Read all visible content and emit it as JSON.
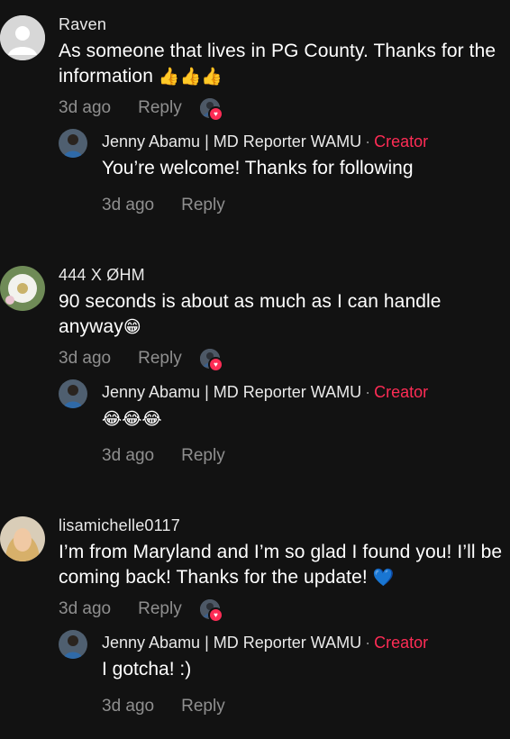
{
  "comments": [
    {
      "username": "Raven",
      "text": "As someone that lives in PG County. Thanks for the information",
      "emoji": "👍👍👍",
      "time": "3d ago",
      "reply_label": "Reply",
      "reply": {
        "author": "Jenny Abamu | MD Reporter WAMU",
        "separator": "·",
        "badge": "Creator",
        "text": "You’re welcome! Thanks for following",
        "emoji": "",
        "time": "3d ago",
        "reply_label": "Reply"
      }
    },
    {
      "username": "444 X ØHM",
      "text": "90 seconds is about as much as I can handle anyway",
      "emoji": "😁",
      "time": "3d ago",
      "reply_label": "Reply",
      "reply": {
        "author": "Jenny Abamu | MD Reporter WAMU",
        "separator": "·",
        "badge": "Creator",
        "text": "",
        "emoji": "😂😂😂",
        "time": "3d ago",
        "reply_label": "Reply"
      }
    },
    {
      "username": "lisamichelle0117",
      "text": "I’m from Maryland and I’m so glad I found you! I’ll be coming back! Thanks for the update!",
      "emoji": "💙",
      "time": "3d ago",
      "reply_label": "Reply",
      "reply": {
        "author": "Jenny Abamu | MD Reporter WAMU",
        "separator": "·",
        "badge": "Creator",
        "text": "I gotcha! :)",
        "emoji": "",
        "time": "3d ago",
        "reply_label": "Reply"
      }
    }
  ],
  "colors": {
    "background": "#121212",
    "creator": "#fe2c55",
    "muted": "#8f8f8f"
  }
}
